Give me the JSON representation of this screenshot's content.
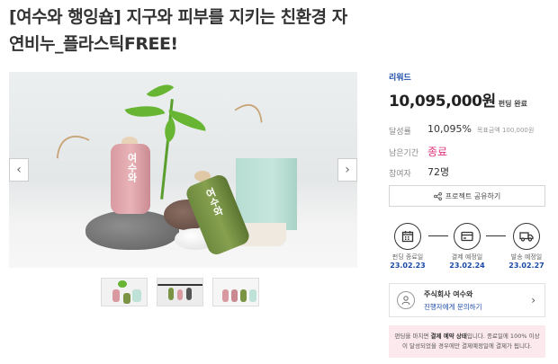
{
  "title": {
    "line1": "[여수와 행잉숍] 지구와 피부를 지키는 친환경 자",
    "line2": "연비누_플라스틱FREE!"
  },
  "gallery": {
    "prev_icon": "chevron-left-icon",
    "next_icon": "chevron-right-icon",
    "prev_glyph": "‹",
    "next_glyph": "›",
    "thumbnail_count": 3
  },
  "product_labels": {
    "pink_soap": "여수와",
    "green_soap": "여수와"
  },
  "funding": {
    "badge": "리워드",
    "amount": "10,095,000원",
    "amount_suffix": "펀딩 완료",
    "stats": [
      {
        "label": "달성률",
        "value": "10,095%",
        "sub": "목표금액 100,000원"
      },
      {
        "label": "남은기간",
        "value": "종료",
        "sub": ""
      },
      {
        "label": "참여자",
        "value": "72명",
        "sub": ""
      }
    ],
    "share_button": "프로젝트 공유하기",
    "share_icon": "share-icon"
  },
  "steps": [
    {
      "icon": "calendar-icon",
      "label": "펀딩 종료일",
      "date": "23.02.23"
    },
    {
      "icon": "card-icon",
      "label": "결제 예정일",
      "date": "23.02.24"
    },
    {
      "icon": "truck-icon",
      "label": "발송 예정일",
      "date": "23.02.27"
    }
  ],
  "company": {
    "name": "주식회사 여수와",
    "link": "진행자에게 문의하기",
    "avatar_icon": "user-avatar-icon",
    "chevron_glyph": "›"
  },
  "notice": {
    "line1_a": "펀딩을 마치면 ",
    "line1_b": "결제 예약 상태",
    "line1_c": "입니다. 종료일에 100% 이상",
    "line2": "이 달성되었을 경우에만 결제예정일에 결제가 됩니다."
  },
  "colors": {
    "accent_blue": "#1a4aa8",
    "accent_pink": "#e0377c",
    "notice_bg": "#fbe9ee"
  }
}
